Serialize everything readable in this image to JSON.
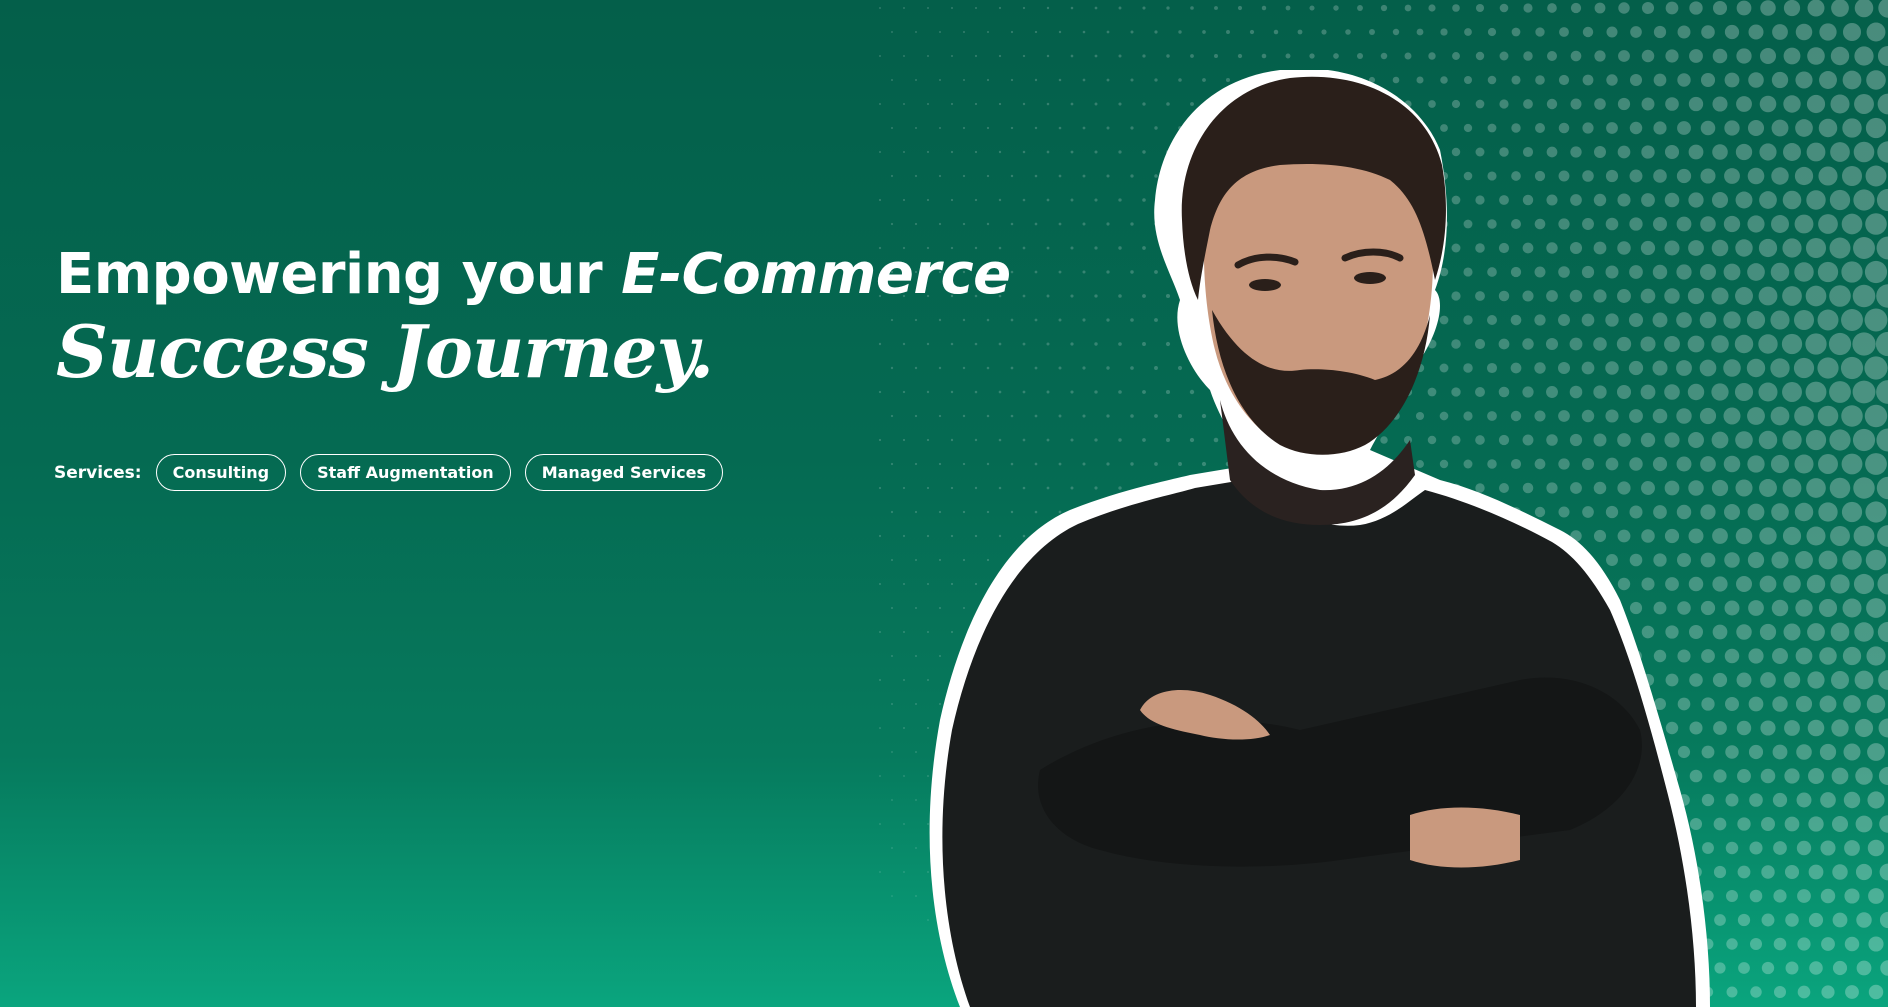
{
  "hero": {
    "headline_part1": "Empowering your ",
    "headline_emphasis": "E-Commerce",
    "headline_line2": "Success Journey.",
    "services_label": "Services:",
    "services": [
      "Consulting",
      "Staff Augmentation",
      "Managed Services"
    ]
  },
  "colors": {
    "background_top": "#045f4a",
    "background_bottom": "#0aa57e",
    "text": "#ffffff",
    "sweater": "#1a1d1d"
  },
  "image": {
    "subject": "portrait-photo"
  }
}
